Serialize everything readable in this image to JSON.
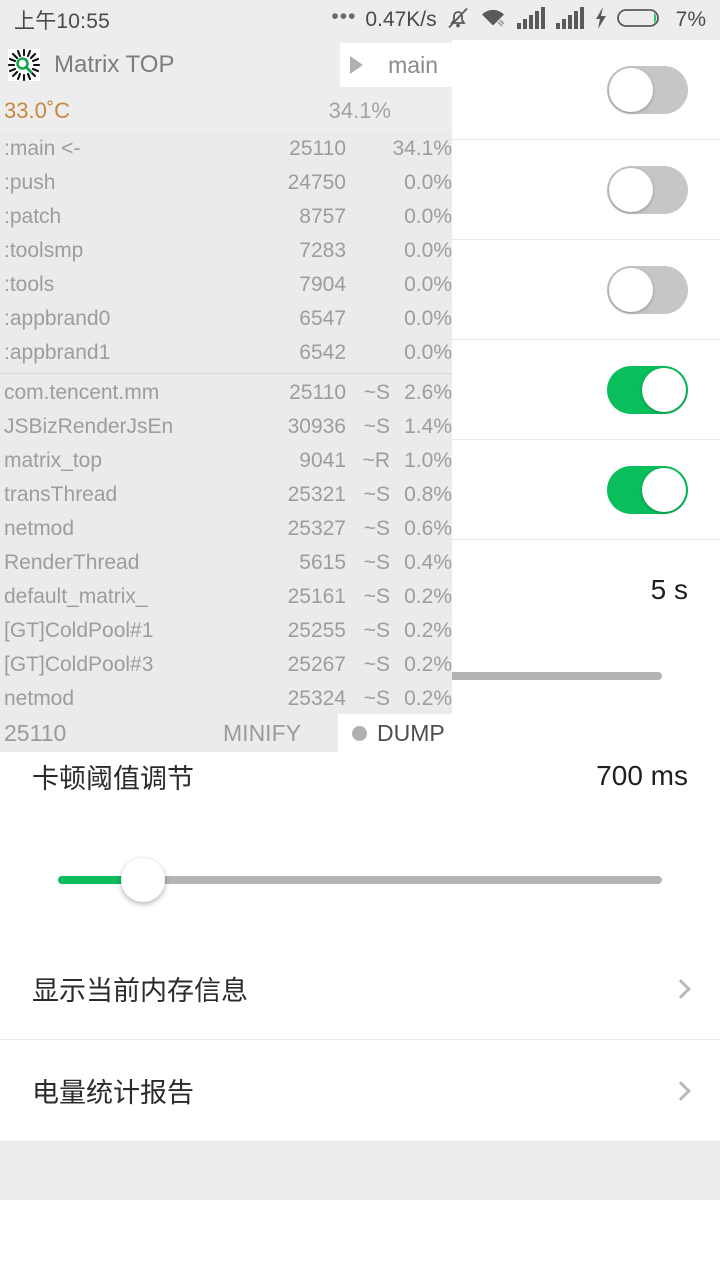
{
  "status_bar": {
    "time": "上午10:55",
    "dots": "•••",
    "net_speed": "0.47K/s",
    "icons": [
      "mute-bell-icon",
      "wifi-icon",
      "signal-bars-icon",
      "signal-bars-icon",
      "lightning-bolt-icon",
      "battery-icon"
    ],
    "battery_percent": "7%"
  },
  "overlay": {
    "app_name": "Matrix TOP",
    "logo_icon": "matrix-starburst-icon",
    "tab": {
      "play_icon": "play-triangle-icon",
      "label": "main"
    },
    "temperature": "33.0˚C",
    "total_cpu": "34.1%",
    "processes": [
      {
        "name": ":main <-",
        "pid": "25110",
        "state": "",
        "cpu": "34.1%"
      },
      {
        "name": ":push",
        "pid": "24750",
        "state": "",
        "cpu": "0.0%"
      },
      {
        "name": ":patch",
        "pid": "8757",
        "state": "",
        "cpu": "0.0%"
      },
      {
        "name": ":toolsmp",
        "pid": "7283",
        "state": "",
        "cpu": "0.0%"
      },
      {
        "name": ":tools",
        "pid": "7904",
        "state": "",
        "cpu": "0.0%"
      },
      {
        "name": ":appbrand0",
        "pid": "6547",
        "state": "",
        "cpu": "0.0%"
      },
      {
        "name": ":appbrand1",
        "pid": "6542",
        "state": "",
        "cpu": "0.0%"
      }
    ],
    "threads": [
      {
        "name": "com.tencent.mm",
        "pid": "25110",
        "state": "~S",
        "cpu": "2.6%"
      },
      {
        "name": "JSBizRenderJsEn",
        "pid": "30936",
        "state": "~S",
        "cpu": "1.4%"
      },
      {
        "name": "matrix_top",
        "pid": "9041",
        "state": "~R",
        "cpu": "1.0%"
      },
      {
        "name": "transThread",
        "pid": "25321",
        "state": "~S",
        "cpu": "0.8%"
      },
      {
        "name": "netmod",
        "pid": "25327",
        "state": "~S",
        "cpu": "0.6%"
      },
      {
        "name": "RenderThread",
        "pid": "5615",
        "state": "~S",
        "cpu": "0.4%"
      },
      {
        "name": "default_matrix_",
        "pid": "25161",
        "state": "~S",
        "cpu": "0.2%"
      },
      {
        "name": "[GT]ColdPool#1",
        "pid": "25255",
        "state": "~S",
        "cpu": "0.2%"
      },
      {
        "name": "[GT]ColdPool#3",
        "pid": "25267",
        "state": "~S",
        "cpu": "0.2%"
      },
      {
        "name": "netmod",
        "pid": "25324",
        "state": "~S",
        "cpu": "0.2%"
      }
    ],
    "footer": {
      "pid": "25110",
      "minify_label": "MINIFY",
      "dump_label": "DUMP",
      "dump_dot_icon": "record-dot-icon"
    }
  },
  "settings": {
    "rows": [
      {
        "label": "",
        "value": "",
        "control": "toggle",
        "on": false
      },
      {
        "label": "",
        "value": "",
        "control": "toggle",
        "on": false
      },
      {
        "label": "",
        "value": "",
        "control": "toggle",
        "on": false
      },
      {
        "label": "",
        "value": "",
        "control": "toggle",
        "on": true
      },
      {
        "label": "",
        "value": "",
        "control": "toggle",
        "on": true
      },
      {
        "label": "",
        "value": "5 s",
        "control": "value"
      }
    ],
    "slider_interval": {
      "fill_percent": 20,
      "thumb_percent": 20
    },
    "lag_threshold": {
      "label": "卡顿阈值调节",
      "value": "700 ms",
      "fill_percent": 14,
      "thumb_percent": 14
    },
    "links": [
      {
        "label": "显示当前内存信息",
        "chevron_icon": "chevron-right-icon"
      },
      {
        "label": "电量统计报告",
        "chevron_icon": "chevron-right-icon"
      }
    ]
  },
  "colors": {
    "accent_green": "#09bf5b",
    "slider_green": "#0ebd5c",
    "temp_orange": "#c8873f",
    "page_bg": "#ffffff",
    "chrome_grey": "#ededed"
  }
}
